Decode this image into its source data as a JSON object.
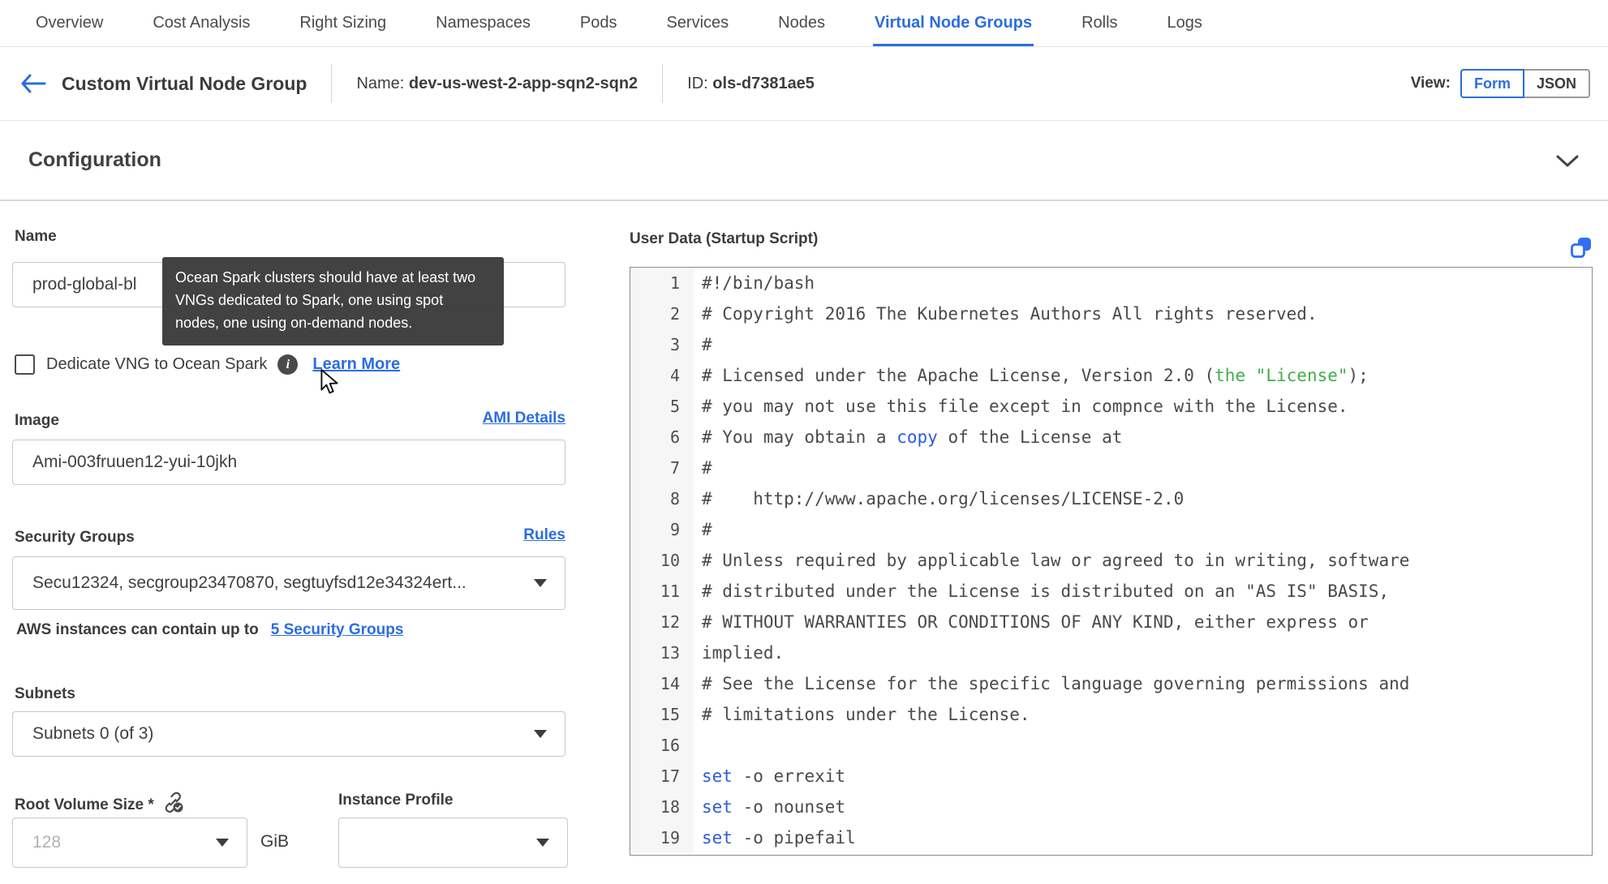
{
  "nav": {
    "tabs": [
      {
        "label": "Overview",
        "active": false
      },
      {
        "label": "Cost Analysis",
        "active": false
      },
      {
        "label": "Right Sizing",
        "active": false
      },
      {
        "label": "Namespaces",
        "active": false
      },
      {
        "label": "Pods",
        "active": false
      },
      {
        "label": "Services",
        "active": false
      },
      {
        "label": "Nodes",
        "active": false
      },
      {
        "label": "Virtual Node Groups",
        "active": true
      },
      {
        "label": "Rolls",
        "active": false
      },
      {
        "label": "Logs",
        "active": false
      }
    ]
  },
  "header": {
    "title": "Custom Virtual Node Group",
    "name_label": "Name: ",
    "name_value": "dev-us-west-2-app-sqn2-sqn2",
    "id_label": "ID: ",
    "id_value": "ols-d7381ae5",
    "view_label": "View:",
    "form_button": "Form",
    "json_button": "JSON",
    "active_view": "Form"
  },
  "section": {
    "title": "Configuration"
  },
  "form": {
    "name": {
      "label": "Name",
      "value": "prod-global-bl"
    },
    "tooltip": {
      "text": "Ocean Spark clusters should have at least two VNGs dedicated to Spark, one using spot nodes, one using on-demand nodes."
    },
    "dedicate": {
      "label": "Dedicate VNG to Ocean Spark",
      "checked": false,
      "info_icon": "i",
      "learn_more": "Learn More"
    },
    "image": {
      "label": "Image",
      "link": "AMI Details",
      "value": "Ami-003fruuen12-yui-10jkh"
    },
    "security_groups": {
      "label": "Security Groups",
      "link": "Rules",
      "value": "Secu12324, secgroup23470870, segtuyfsd12e34324ert...",
      "hint_text": "AWS instances can contain up to",
      "hint_link": "5 Security Groups"
    },
    "subnets": {
      "label": "Subnets",
      "value": "Subnets 0 (of 3)"
    },
    "root_volume": {
      "label": "Root Volume Size *",
      "placeholder": "128",
      "unit": "GiB"
    },
    "instance_profile": {
      "label": "Instance Profile",
      "value": ""
    }
  },
  "user_data": {
    "label": "User Data (Startup Script)",
    "copy_icon": "copy-icon",
    "lines": [
      {
        "n": "1",
        "segs": [
          [
            "#!/bin/bash",
            "d"
          ]
        ]
      },
      {
        "n": "2",
        "segs": [
          [
            "# Copyright 2016 The Kubernetes Authors All rights reserved.",
            "d"
          ]
        ]
      },
      {
        "n": "3",
        "segs": [
          [
            "#",
            "d"
          ]
        ]
      },
      {
        "n": "4",
        "segs": [
          [
            "# Licensed under the Apache License, Version 2.0 (",
            "d"
          ],
          [
            "the \"License\"",
            "g"
          ],
          [
            ");",
            "d"
          ]
        ]
      },
      {
        "n": "5",
        "segs": [
          [
            "# you may not use this file except in compnce with the License.",
            "d"
          ]
        ]
      },
      {
        "n": "6",
        "segs": [
          [
            "# You may obtain a ",
            "d"
          ],
          [
            "copy",
            "b"
          ],
          [
            " of the License at",
            "d"
          ]
        ]
      },
      {
        "n": "7",
        "segs": [
          [
            "#",
            "d"
          ]
        ]
      },
      {
        "n": "8",
        "segs": [
          [
            "#    http://www.apache.org/licenses/LICENSE-2.0",
            "d"
          ]
        ]
      },
      {
        "n": "9",
        "segs": [
          [
            "#",
            "d"
          ]
        ]
      },
      {
        "n": "10",
        "segs": [
          [
            "# Unless required by applicable law or agreed to in writing, software",
            "d"
          ]
        ]
      },
      {
        "n": "11",
        "segs": [
          [
            "# distributed under the License is distributed on an \"AS IS\" BASIS,",
            "d"
          ]
        ]
      },
      {
        "n": "12",
        "segs": [
          [
            "# WITHOUT WARRANTIES OR CONDITIONS OF ANY KIND, either express or",
            "d"
          ]
        ]
      },
      {
        "n": "13",
        "segs": [
          [
            "implied.",
            "d"
          ]
        ]
      },
      {
        "n": "14",
        "segs": [
          [
            "# See the License for the specific language governing permissions and",
            "d"
          ]
        ]
      },
      {
        "n": "15",
        "segs": [
          [
            "# limitations under the License.",
            "d"
          ]
        ]
      },
      {
        "n": "16",
        "segs": [
          [
            "",
            "d"
          ]
        ]
      },
      {
        "n": "17",
        "segs": [
          [
            "set",
            "b"
          ],
          [
            " -o errexit",
            "d"
          ]
        ]
      },
      {
        "n": "18",
        "segs": [
          [
            "set",
            "b"
          ],
          [
            " -o nounset",
            "d"
          ]
        ]
      },
      {
        "n": "19",
        "segs": [
          [
            "set",
            "b"
          ],
          [
            " -o pipefail",
            "d"
          ]
        ]
      }
    ]
  },
  "colors": {
    "accent_blue": "#2b6de0",
    "code_green": "#3fae4a",
    "code_blue": "#2d5bd9",
    "tooltip_bg": "#383838"
  }
}
